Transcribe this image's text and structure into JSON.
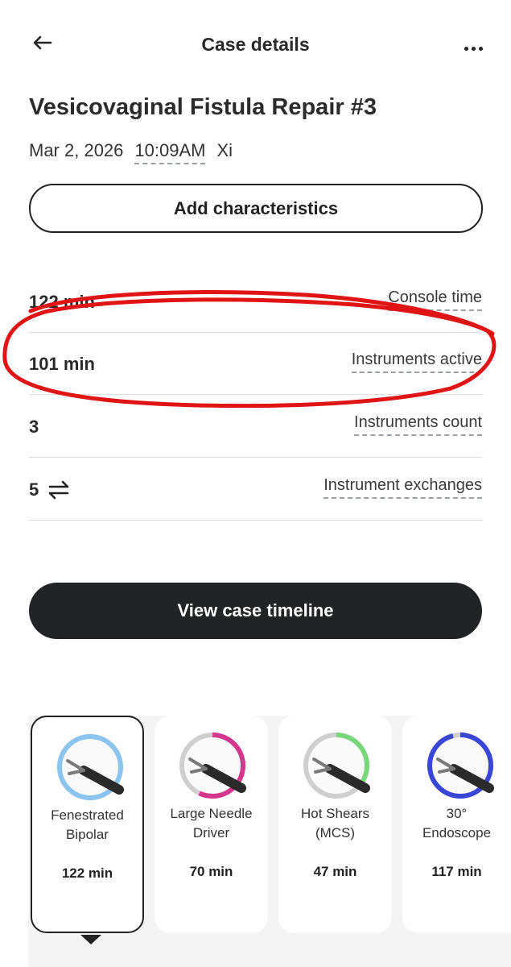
{
  "header": {
    "title": "Case details",
    "back_icon": "arrow-left-icon",
    "more_icon": "more-horizontal-icon"
  },
  "case": {
    "title": "Vesicovaginal Fistula Repair #3",
    "date": "Mar 2, 2026",
    "time": "10:09AM",
    "system": "Xi"
  },
  "actions": {
    "add_characteristics": "Add characteristics",
    "view_timeline": "View case timeline"
  },
  "stats": [
    {
      "value": "122 min",
      "label": "Console time"
    },
    {
      "value": "101 min",
      "label": "Instruments active"
    },
    {
      "value": "3",
      "label": "Instruments count"
    },
    {
      "value": "5",
      "label": "Instrument exchanges",
      "icon": "swap-arrows-icon"
    }
  ],
  "instruments": [
    {
      "name_line1": "Fenestrated",
      "name_line2": "Bipolar",
      "time": "122 min",
      "ring_color": "#8cc4f0",
      "fraction": 1.0,
      "selected": true
    },
    {
      "name_line1": "Large Needle",
      "name_line2": "Driver",
      "time": "70 min",
      "ring_color": "#d4378c",
      "fraction": 0.57,
      "selected": false
    },
    {
      "name_line1": "Hot Shears",
      "name_line2": "(MCS)",
      "time": "47 min",
      "ring_color": "#79d67a",
      "fraction": 0.38,
      "selected": false
    },
    {
      "name_line1": "30°",
      "name_line2": "Endoscope",
      "time": "117 min",
      "ring_color": "#3a46d6",
      "fraction": 0.96,
      "selected": false
    }
  ],
  "annotation": {
    "color": "#e01414"
  }
}
